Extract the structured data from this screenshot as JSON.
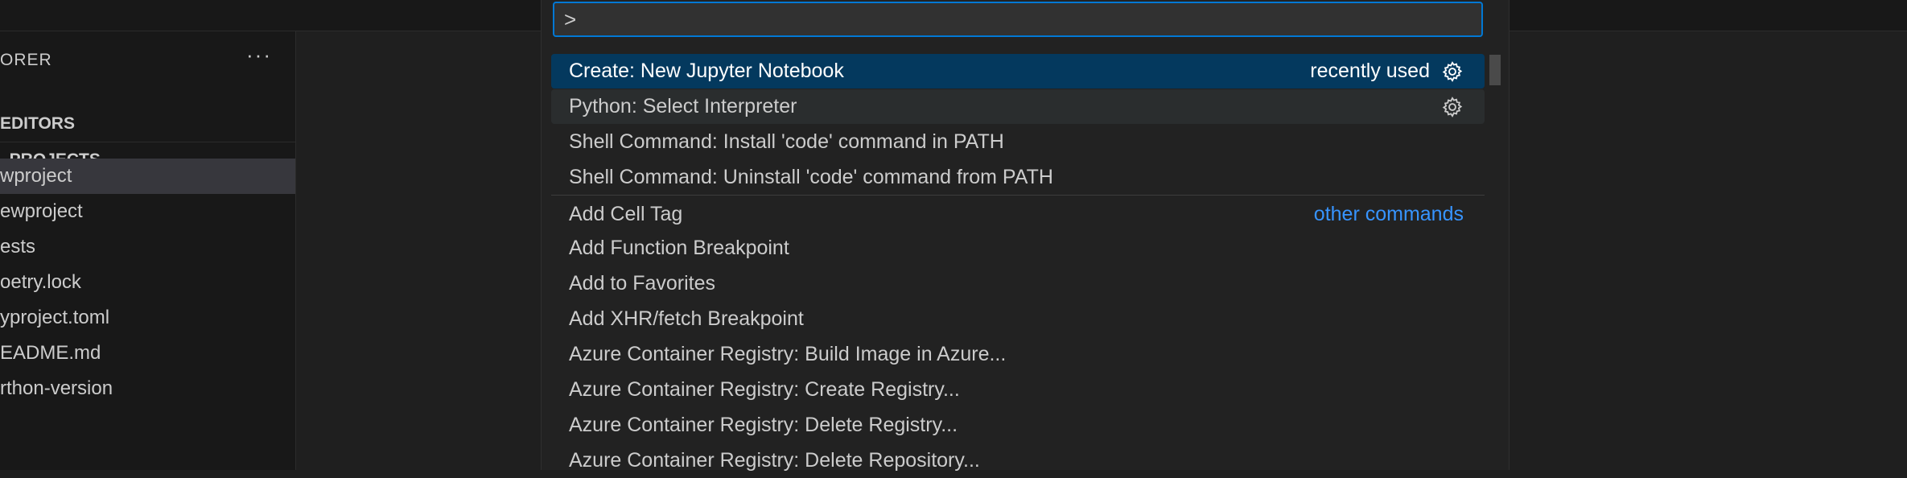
{
  "sidebar": {
    "header": "ORER",
    "more_label": "···",
    "section_editors": "EDITORS",
    "section_projects": "_PROJECTS",
    "items": [
      {
        "label": "wproject"
      },
      {
        "label": "ewproject"
      },
      {
        "label": "ests"
      },
      {
        "label": "oetry.lock"
      },
      {
        "label": "yproject.toml"
      },
      {
        "label": "EADME.md"
      },
      {
        "label": "rthon-version"
      }
    ]
  },
  "palette": {
    "input_value": ">",
    "gear_icon": "gear-icon",
    "commands": [
      {
        "label": "Create: New Jupyter Notebook",
        "tag": "recently used"
      },
      {
        "label": "Python: Select Interpreter",
        "tag": ""
      },
      {
        "label": "Shell Command: Install 'code' command in PATH",
        "tag": ""
      },
      {
        "label": "Shell Command: Uninstall 'code' command from PATH",
        "tag": ""
      },
      {
        "label": "Add Cell Tag",
        "tag": "other commands"
      },
      {
        "label": "Add Function Breakpoint",
        "tag": ""
      },
      {
        "label": "Add to Favorites",
        "tag": ""
      },
      {
        "label": "Add XHR/fetch Breakpoint",
        "tag": ""
      },
      {
        "label": "Azure Container Registry: Build Image in Azure...",
        "tag": ""
      },
      {
        "label": "Azure Container Registry: Create Registry...",
        "tag": ""
      },
      {
        "label": "Azure Container Registry: Delete Registry...",
        "tag": ""
      },
      {
        "label": "Azure Container Registry: Delete Repository...",
        "tag": ""
      }
    ]
  },
  "colors": {
    "accent": "#0078d4",
    "selected_row": "#04395e",
    "link": "#3794ff"
  }
}
